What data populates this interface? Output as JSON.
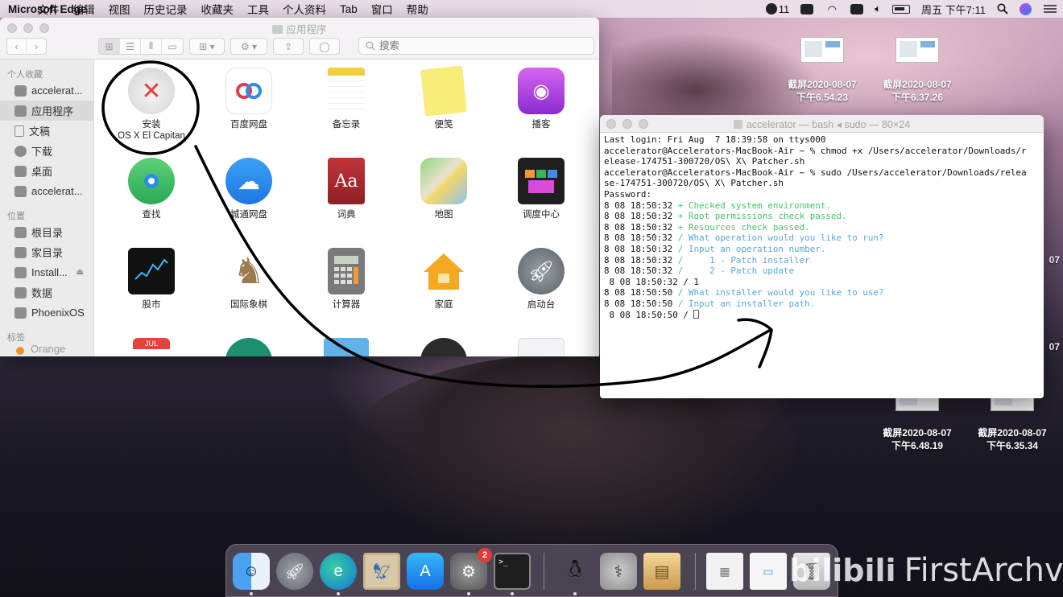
{
  "menubar": {
    "apple_glyph": "",
    "app_name": "Microsoft Edge",
    "menus": [
      "文件",
      "编辑",
      "视图",
      "历史记录",
      "收藏夹",
      "工具",
      "个人资料",
      "Tab",
      "窗口",
      "帮助"
    ],
    "notification_count": "11",
    "clock": "周五 下午7:11"
  },
  "finder": {
    "title": "应用程序",
    "search_placeholder": "搜索",
    "sidebar": {
      "favorites_heading": "个人收藏",
      "favorites": [
        "accelerat...",
        "应用程序",
        "文稿",
        "下载",
        "桌面",
        "accelerat..."
      ],
      "locations_heading": "位置",
      "locations": [
        "根目录",
        "家目录",
        "Install...",
        "数据",
        "PhoenixOS"
      ],
      "tags_heading": "标签",
      "tags": [
        "Orange"
      ]
    },
    "apps": [
      {
        "line1": "安装",
        "line2": "OS X El Capitan"
      },
      {
        "line1": "百度网盘",
        "line2": ""
      },
      {
        "line1": "备忘录",
        "line2": ""
      },
      {
        "line1": "便笺",
        "line2": ""
      },
      {
        "line1": "播客",
        "line2": ""
      },
      {
        "line1": "查找",
        "line2": ""
      },
      {
        "line1": "城通网盘",
        "line2": ""
      },
      {
        "line1": "词典",
        "line2": ""
      },
      {
        "line1": "地图",
        "line2": ""
      },
      {
        "line1": "调度中心",
        "line2": ""
      },
      {
        "line1": "股市",
        "line2": ""
      },
      {
        "line1": "国际象棋",
        "line2": ""
      },
      {
        "line1": "计算器",
        "line2": ""
      },
      {
        "line1": "家庭",
        "line2": ""
      },
      {
        "line1": "启动台",
        "line2": ""
      }
    ],
    "partial_icons": {
      "calendar_month": "JUL",
      "dictionary_glyph": "Aa"
    }
  },
  "desktop": {
    "screenshots": [
      {
        "line1": "截屏2020-08-07",
        "line2": "下午6.54.23"
      },
      {
        "line1": "截屏2020-08-07",
        "line2": "下午6.37.26"
      },
      {
        "line1": "截屏2020-08-07",
        "line2": "下午6.48.19"
      },
      {
        "line1": "截屏2020-08-07",
        "line2": "下午6.35.34"
      }
    ],
    "edge_fragments": [
      "07",
      "07"
    ]
  },
  "terminal": {
    "title": "accelerator — bash ◂ sudo — 80×24",
    "lines": [
      {
        "text": "Last login: Fri Aug  7 18:39:58 on ttys000",
        "status": ""
      },
      {
        "text": "accelerator@Accelerators-MacBook-Air ~ % chmod +x /Users/accelerator/Downloads/r",
        "status": ""
      },
      {
        "text": "elease-174751-300720/OS\\ X\\ Patcher.sh",
        "status": ""
      },
      {
        "text": "accelerator@Accelerators-MacBook-Air ~ % sudo /Users/accelerator/Downloads/relea",
        "status": ""
      },
      {
        "text": "se-174751-300720/OS\\ X\\ Patcher.sh",
        "status": ""
      },
      {
        "text": "Password:",
        "status": ""
      },
      {
        "text": "8 08 18:50:32 ",
        "status": "+ Checked system environment.",
        "color": "green"
      },
      {
        "text": "8 08 18:50:32 ",
        "status": "+ Root permissions check passed.",
        "color": "green"
      },
      {
        "text": "8 08 18:50:32 ",
        "status": "+ Resources check passed.",
        "color": "green"
      },
      {
        "text": "8 08 18:50:32 ",
        "status": "/ What operation would you like to run?",
        "color": "blue"
      },
      {
        "text": "8 08 18:50:32 ",
        "status": "/ Input an operation number.",
        "color": "blue"
      },
      {
        "text": "8 08 18:50:32 ",
        "status": "/     1 - Patch installer",
        "color": "blue"
      },
      {
        "text": "8 08 18:50:32 ",
        "status": "/     2 - Patch update",
        "color": "blue"
      },
      {
        "text": " 8 08 18:50:32 / 1",
        "status": ""
      },
      {
        "text": "8 08 18:50:50 ",
        "status": "/ What installer would you like to use?",
        "color": "blue"
      },
      {
        "text": "8 08 18:50:50 ",
        "status": "/ Input an installer path.",
        "color": "blue"
      },
      {
        "text": " 8 08 18:50:50 / ",
        "status": "",
        "cursor": true
      }
    ]
  },
  "dock": {
    "apps": [
      "finder-icon",
      "launchpad-icon",
      "edge-icon",
      "preview-icon",
      "app-store-icon",
      "system-preferences-icon",
      "terminal-icon",
      "qq-icon",
      "disk-utility-icon",
      "archive-utility-icon",
      "recent-window-icon",
      "recent-window-icon",
      "trash-icon"
    ],
    "system_preferences_badge": "2",
    "terminal_glyph": ">_"
  },
  "watermark": {
    "logo": "bilibili",
    "text": "FirstArchve"
  },
  "colors": {
    "terminal_green": "#3dc96b",
    "terminal_blue": "#5aa7dc",
    "badge_red": "#e63a35",
    "annotation": "#000000"
  }
}
